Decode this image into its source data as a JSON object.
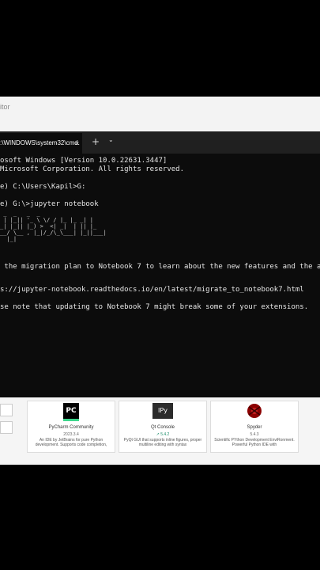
{
  "background_window": {
    "title_fragment": "itor"
  },
  "terminal": {
    "tab_title": ":\\WINDOWS\\system32\\cmd.",
    "tab_close": "×",
    "new_tab": "+",
    "dropdown": "⌄",
    "lines": [
      "osoft Windows [Version 10.0.22631.3447]",
      "Microsoft Corporation. All rights reserved.",
      "",
      "e) C:\\Users\\Kapil>G:",
      "",
      "e) G:\\>jupyter notebook"
    ],
    "ascii_art": " _  _   _  _\n | |_|| '_ \\ \\/ / |_ |_ _| |\n_| |_|| |_) >  <| _|  | || |_\n__/ \\__ , |_|/_/\\_\\___| |_||___|\n  |_|",
    "lines2": [
      " the migration plan to Notebook 7 to learn about the new features and the ac",
      "",
      "s://jupyter-notebook.readthedocs.io/en/latest/migrate_to_notebook7.html",
      "",
      "se note that updating to Notebook 7 might break some of your extensions."
    ]
  },
  "apps": [
    {
      "name": "PyCharm Community",
      "version": "2023.3.4",
      "description": "An IDE by JetBrains for pure Python development. Supports code completion,",
      "logo_text": "PC",
      "icon": "pycharm-icon"
    },
    {
      "name": "Qt Console",
      "version": "↗ 5.4.2",
      "description": "PyQt GUI that supports inline figures, proper multiline editing with syntax",
      "logo_text": "IPy",
      "icon": "qtconsole-icon"
    },
    {
      "name": "Spyder",
      "version": "5.4.3",
      "description": "Scientific PYthon Development EnviRonment. Powerful Python IDE with",
      "logo_text": "",
      "icon": "spyder-icon"
    }
  ]
}
